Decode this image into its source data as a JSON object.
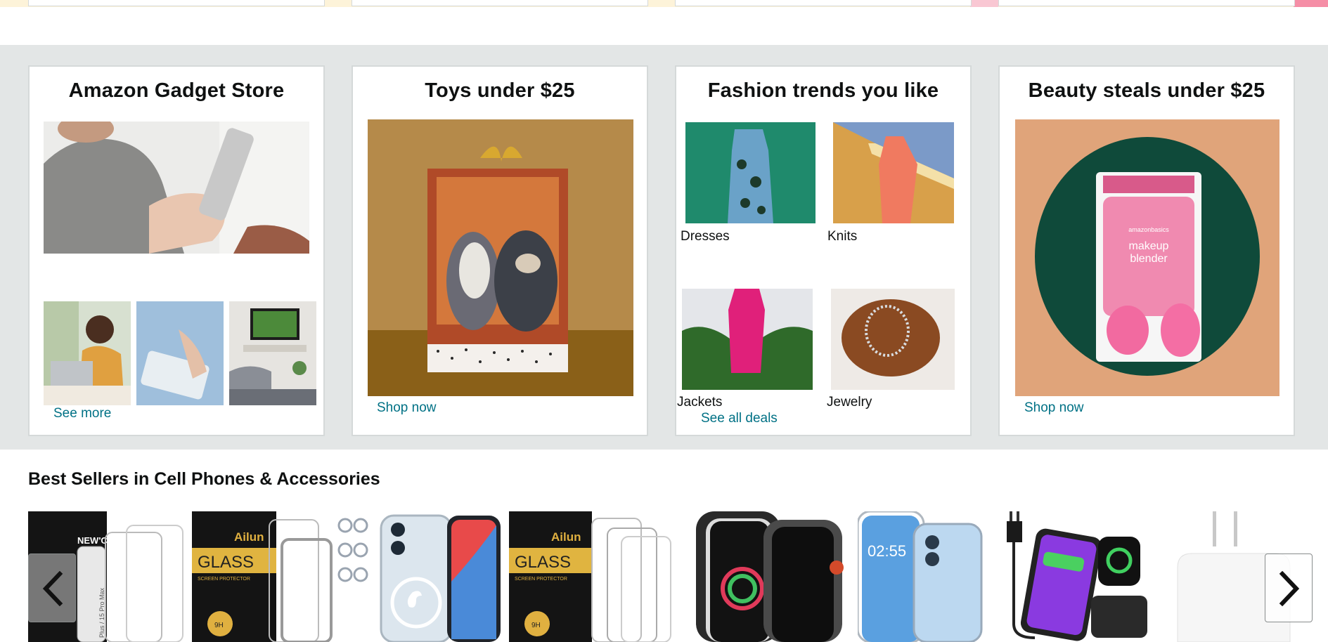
{
  "cards": [
    {
      "title": "Amazon Gadget Store",
      "link": "See more"
    },
    {
      "title": "Toys under $25",
      "link": "Shop now"
    },
    {
      "title": "Fashion trends you like",
      "link": "See all deals",
      "tiles": [
        "Dresses",
        "Knits",
        "Jackets",
        "Jewelry"
      ]
    },
    {
      "title": "Beauty steals under $25",
      "link": "Shop now"
    }
  ],
  "product_texts": {
    "newc_brand": "NEW'C",
    "newc_side": "Plus / 15 Pro Max",
    "ailun_brand": "Ailun",
    "ailun_glass": "GLASS",
    "ailun_sub": "SCREEN PROTECTOR",
    "ailun_9h": "9H",
    "phone_time": "02:55",
    "makeup_brand": "amazonbasics",
    "makeup_line1": "makeup",
    "makeup_line2": "blender"
  },
  "bestsellers": {
    "title": "Best Sellers in Cell Phones & Accessories"
  },
  "icons": {
    "prev": "chevron-left-icon",
    "next": "chevron-right-icon"
  },
  "colors": {
    "link": "#007185",
    "text": "#0f1111",
    "band": "#e3e6e6"
  }
}
